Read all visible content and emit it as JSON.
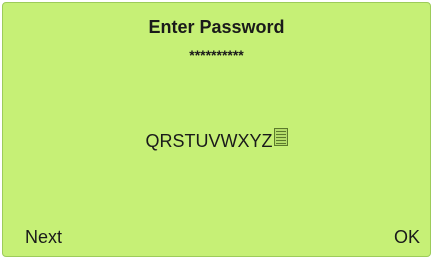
{
  "screen": {
    "title": "Enter Password",
    "masked_password": "**********",
    "character_set": "QRSTUVWXYZ",
    "cursor_icon": "block-cursor-icon",
    "background_color": "#c6f076"
  },
  "softkeys": {
    "left_label": "Next",
    "right_label": "OK"
  }
}
